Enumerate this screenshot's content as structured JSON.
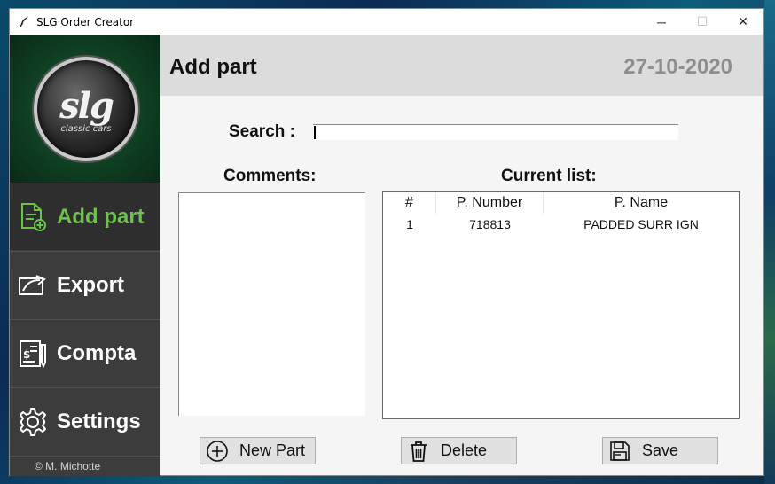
{
  "window": {
    "title": "SLG Order Creator",
    "minimize": "─",
    "maximize": "☐",
    "close": "✕"
  },
  "logo": {
    "brand": "slg",
    "subtitle": "classic cars"
  },
  "sidebar": {
    "items": [
      {
        "label": "Add part",
        "icon": "document-add-icon",
        "active": true
      },
      {
        "label": "Export",
        "icon": "export-icon",
        "active": false
      },
      {
        "label": "Compta",
        "icon": "accounting-icon",
        "active": false
      },
      {
        "label": "Settings",
        "icon": "gear-icon",
        "active": false
      }
    ],
    "copyright": "©  M. Michotte"
  },
  "header": {
    "title": "Add part",
    "date": "27-10-2020"
  },
  "search": {
    "label": "Search :",
    "value": ""
  },
  "comments": {
    "label": "Comments:",
    "value": ""
  },
  "current_list": {
    "label": "Current list:",
    "columns": [
      "#",
      "P. Number",
      "P. Name"
    ],
    "rows": [
      {
        "num": "1",
        "part_number": "718813",
        "part_name": "PADDED SURR IGN"
      }
    ]
  },
  "buttons": {
    "new_part": "New Part",
    "delete": "Delete",
    "save": "Save"
  },
  "colors": {
    "active_nav": "#6cc24a",
    "sidebar_bg": "#3c3c3c",
    "header_bg": "#dcdcdc",
    "date_color": "#8e8e8e"
  }
}
